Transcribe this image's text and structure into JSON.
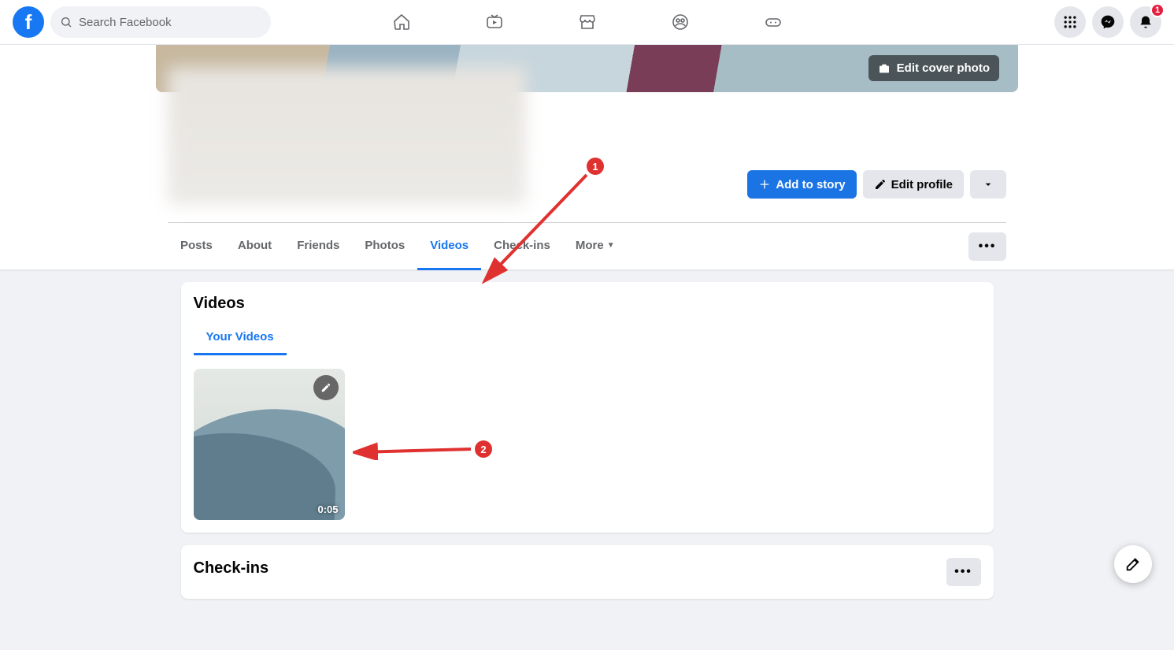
{
  "search": {
    "placeholder": "Search Facebook"
  },
  "notifications": {
    "count": "1"
  },
  "cover": {
    "edit_label": "Edit cover photo"
  },
  "actions": {
    "add_story": "Add to story",
    "edit_profile": "Edit profile"
  },
  "tabs": {
    "posts": "Posts",
    "about": "About",
    "friends": "Friends",
    "photos": "Photos",
    "videos": "Videos",
    "checkins": "Check-ins",
    "more": "More"
  },
  "videos_card": {
    "title": "Videos",
    "subtab": "Your Videos",
    "items": [
      {
        "duration": "0:05"
      }
    ]
  },
  "checkins_card": {
    "title": "Check-ins"
  },
  "annotations": {
    "one": "1",
    "two": "2"
  }
}
